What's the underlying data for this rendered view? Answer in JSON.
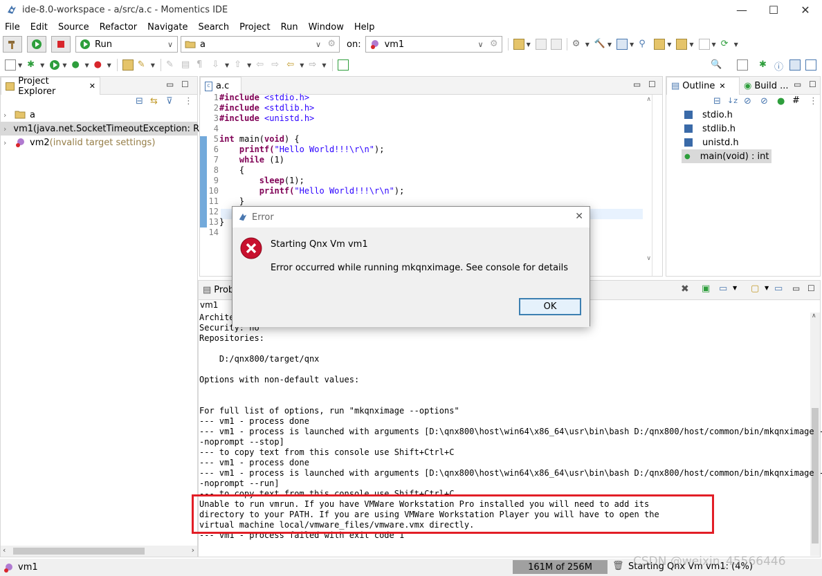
{
  "window": {
    "title": "ide-8.0-workspace - a/src/a.c - Momentics IDE",
    "minimize": "—",
    "maximize": "☐",
    "close": "✕"
  },
  "menu": [
    "File",
    "Edit",
    "Source",
    "Refactor",
    "Navigate",
    "Search",
    "Project",
    "Run",
    "Window",
    "Help"
  ],
  "toolbar": {
    "launch_mode": "Run",
    "launch_config": "a",
    "on_label": "on:",
    "target": "vm1"
  },
  "project_explorer": {
    "tab": "Project Explorer",
    "items": [
      {
        "name": "a",
        "note": ""
      },
      {
        "name": "vm1",
        "note": " (java.net.SocketTimeoutException: Re"
      },
      {
        "name": "vm2",
        "note": " (invalid target settings)"
      }
    ]
  },
  "editor": {
    "tab": "a.c",
    "lines": [
      {
        "n": "1",
        "segs": [
          {
            "t": "#include ",
            "c": "kw"
          },
          {
            "t": "<stdio.h>",
            "c": "str"
          }
        ]
      },
      {
        "n": "2",
        "segs": [
          {
            "t": "#include ",
            "c": "kw"
          },
          {
            "t": "<stdlib.h>",
            "c": "str"
          }
        ]
      },
      {
        "n": "3",
        "segs": [
          {
            "t": "#include ",
            "c": "kw"
          },
          {
            "t": "<unistd.h>",
            "c": "str"
          }
        ]
      },
      {
        "n": "4",
        "segs": []
      },
      {
        "n": "5",
        "segs": [
          {
            "t": "int ",
            "c": "kw"
          },
          {
            "t": "main(",
            "c": ""
          },
          {
            "t": "void",
            "c": "kw"
          },
          {
            "t": ") {",
            "c": ""
          }
        ]
      },
      {
        "n": "6",
        "segs": [
          {
            "t": "    printf(",
            "c": "fn"
          },
          {
            "t": "\"Hello World!!!\\r\\n\"",
            "c": "str"
          },
          {
            "t": ");",
            "c": ""
          }
        ]
      },
      {
        "n": "7",
        "segs": [
          {
            "t": "    while ",
            "c": "kw"
          },
          {
            "t": "(1)",
            "c": ""
          }
        ]
      },
      {
        "n": "8",
        "segs": [
          {
            "t": "    {",
            "c": ""
          }
        ]
      },
      {
        "n": "9",
        "segs": [
          {
            "t": "        sleep",
            "c": "fn"
          },
          {
            "t": "(1);",
            "c": ""
          }
        ]
      },
      {
        "n": "10",
        "segs": [
          {
            "t": "        printf(",
            "c": "fn"
          },
          {
            "t": "\"Hello World!!!\\r\\n\"",
            "c": "str"
          },
          {
            "t": ");",
            "c": ""
          }
        ]
      },
      {
        "n": "11",
        "segs": [
          {
            "t": "    }",
            "c": ""
          }
        ]
      },
      {
        "n": "12",
        "segs": []
      },
      {
        "n": "13",
        "segs": [
          {
            "t": "}",
            "c": ""
          }
        ]
      },
      {
        "n": "14",
        "segs": []
      }
    ]
  },
  "outline": {
    "tab": "Outline",
    "tab2": "Build ...",
    "items": [
      "stdio.h",
      "stdlib.h",
      "unistd.h",
      "main(void) : int"
    ]
  },
  "console": {
    "tab": "Prob",
    "name": "vm1",
    "lines": [
      "Archite",
      "Security: no",
      "Repositories:",
      "",
      "    D:/qnx800/target/qnx",
      "",
      "Options with non-default values:",
      "",
      "",
      "For full list of options, run \"mkqnximage --options\"",
      "--- vm1 - process done",
      "--- vm1 - process is launched with arguments [D:\\qnx800\\host\\win64\\x86_64\\usr\\bin\\bash D:/qnx800/host/common/bin/mkqnximage -",
      "-noprompt --stop]",
      "--- to copy text from this console use Shift+Ctrl+C",
      "--- vm1 - process done",
      "--- vm1 - process is launched with arguments [D:\\qnx800\\host\\win64\\x86_64\\usr\\bin\\bash D:/qnx800/host/common/bin/mkqnximage -",
      "-noprompt --run]",
      "--- to copy text from this console use Shift+Ctrl+C",
      "Unable to run vmrun. If you have VMWare Workstation Pro installed you will need to add its",
      "directory to your PATH. If you are using VMWare Workstation Player you will have to open the",
      "virtual machine local/vmware_files/vmware.vmx directly.",
      "--- vm1 - process failed with exit code 1"
    ]
  },
  "dialog": {
    "title": "Error",
    "heading": "Starting Qnx Vm vm1",
    "message": "Error occurred while running mkqnximage. See console for details",
    "ok": "OK",
    "close": "✕"
  },
  "status": {
    "selected": "vm1",
    "heap": "161M of 256M",
    "job": "Starting Qnx Vm vm1: (4%)",
    "watermark": "CSDN @weixin_45566446"
  },
  "colors": {
    "error_red": "#e21e26",
    "heap_bg": "#a0a0a0",
    "selection": "#d9d9d9"
  }
}
